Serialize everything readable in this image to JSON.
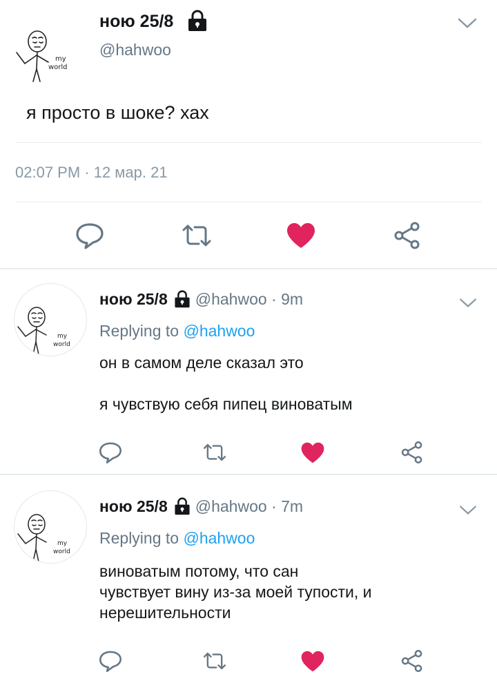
{
  "main_tweet": {
    "display_name": "ною 25/8",
    "handle": "@hahwoo",
    "avatar_text": "my world",
    "text": "я просто в шоке? хах",
    "timestamp": "02:07 PM · 12 мар. 21",
    "liked": true
  },
  "replies": [
    {
      "display_name": "ною 25/8",
      "handle": "@hahwoo · 9m",
      "replying_label": "Replying to ",
      "replying_to": "@hahwoo",
      "lines": [
        "он в самом деле сказал это",
        "",
        "я чувствую себя пипец виноватым"
      ],
      "liked": true
    },
    {
      "display_name": "ною 25/8",
      "handle": "@hahwoo · 7m",
      "replying_label": "Replying to ",
      "replying_to": "@hahwoo",
      "lines": [
        "виноватым потому, что сан",
        "чувствует вину из-за моей тупости, и",
        "нерешительности"
      ],
      "liked": true
    }
  ],
  "colors": {
    "like": "#e0245e",
    "link": "#1da1f2",
    "secondary_text": "#657786",
    "icon_gray": "#657786"
  },
  "icons": [
    "lock-icon",
    "chevron-down-icon",
    "reply-icon",
    "retweet-icon",
    "like-icon",
    "share-icon"
  ]
}
